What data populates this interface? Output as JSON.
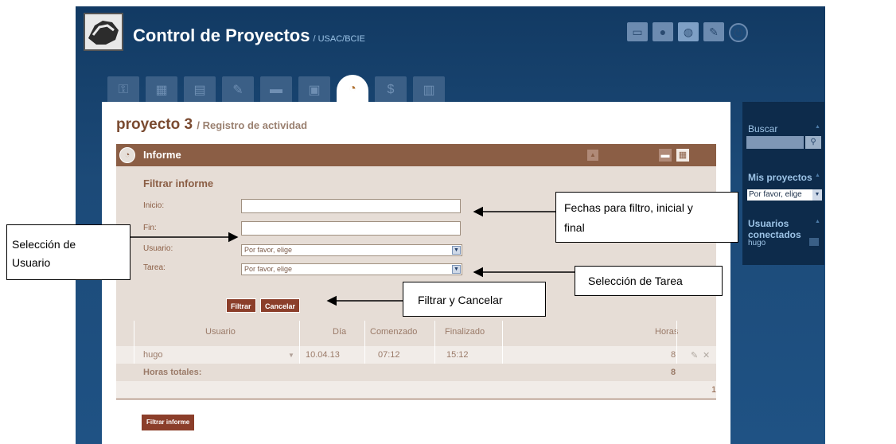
{
  "header": {
    "title": "Control de Proyectos",
    "subtitle": "/ USAC/BCIE"
  },
  "top_icons": [
    "monitor-icon",
    "user-icon",
    "globe-icon",
    "wrench-icon",
    "power-icon"
  ],
  "tabs": [
    "key-icon",
    "calendar-icon",
    "clipboard-icon",
    "edit-icon",
    "save-icon",
    "folder-icon",
    "stopwatch-icon",
    "money-icon",
    "notes-icon"
  ],
  "breadcrumb": {
    "project": "proyecto 3",
    "section": "/ Registro de actividad"
  },
  "panel": {
    "title": "Informe"
  },
  "filter": {
    "title": "Filtrar informe",
    "inicio_label": "Inicio:",
    "fin_label": "Fin:",
    "usuario_label": "Usuario:",
    "usuario_value": "Por favor, elige",
    "tarea_label": "Tarea:",
    "tarea_value": "Por favor, elige",
    "filtrar_btn": "Filtrar",
    "cancelar_btn": "Cancelar"
  },
  "table": {
    "headers": [
      "Usuario",
      "Día",
      "Comenzado",
      "Finalizado",
      "Horas"
    ],
    "row": {
      "usuario": "hugo",
      "dia": "10.04.13",
      "comenzado": "07:12",
      "finalizado": "15:12",
      "horas": "8"
    },
    "total_label": "Horas totales:",
    "total_value": "8",
    "page": "1"
  },
  "filter_report_btn": "Filtrar informe",
  "sidebar": {
    "buscar": "Buscar",
    "mis_proyectos": "Mis proyectos",
    "mis_proyectos_value": "Por favor, elige",
    "usuarios_conectados": "Usuarios conectados",
    "usuario": "hugo"
  },
  "callouts": {
    "usuario_line1": "Selección de",
    "usuario_line2": "Usuario",
    "fechas_line1": "Fechas para filtro, inicial y",
    "fechas_line2": "final",
    "tarea": "Selección de Tarea",
    "filtrar": "Filtrar y Cancelar"
  },
  "colors": {
    "header_bg": "#123a63",
    "panel_brown": "#8b5e45",
    "button_red": "#8b3e2a",
    "filter_bg": "#e6ddd6"
  }
}
